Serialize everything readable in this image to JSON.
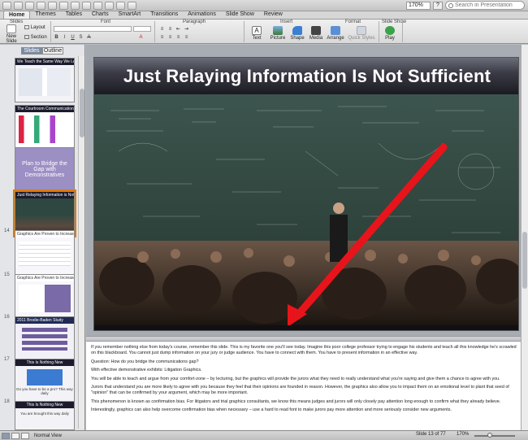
{
  "toolbar": {
    "zoom": "170%",
    "search_placeholder": "Search in Presentation"
  },
  "ribbon_tabs": [
    {
      "label": "Home",
      "active": true
    },
    {
      "label": "Themes"
    },
    {
      "label": "Tables"
    },
    {
      "label": "Charts"
    },
    {
      "label": "SmartArt"
    },
    {
      "label": "Transitions"
    },
    {
      "label": "Animations"
    },
    {
      "label": "Slide Show"
    },
    {
      "label": "Review"
    }
  ],
  "ribbon": {
    "groups": {
      "slides": "Slides",
      "font": "Font",
      "paragraph": "Paragraph",
      "insert": "Insert",
      "format": "Format",
      "slideshow": "Slide Show"
    },
    "new_slide": "New Slide",
    "layout": "Layout",
    "section": "Section",
    "insert_items": [
      "Text",
      "Picture",
      "Shape",
      "Media"
    ],
    "arrange": "Arrange",
    "quick_styles": "Quick Styles",
    "play": "Play"
  },
  "left_pane": {
    "tabs": [
      "Slides",
      "Outline"
    ],
    "slides": [
      {
        "num": "",
        "title": "We Teach the Same Way We Learn"
      },
      {
        "num": "",
        "title": "The Courtroom Communication Gap"
      },
      {
        "num": "",
        "title": "Plan to Bridge the Gap with Demonstratives"
      },
      {
        "num": "",
        "title": "Just Relaying Information is Not Sufficient"
      },
      {
        "num": "14",
        "title": "Graphics Are Proven to Increase Persuasiveness"
      },
      {
        "num": "15",
        "title": "Graphics Are Proven to Increase Persuasiveness"
      },
      {
        "num": "16",
        "title": "2011 Brodie-Baden Study"
      },
      {
        "num": "17",
        "title": "This Is Nothing New"
      },
      {
        "num": "18",
        "title": "This Is Nothing New"
      }
    ],
    "thumb_texts": {
      "s17": "Do you have to be a pro? This way daily",
      "s18": "You are brought this way daily"
    }
  },
  "slide": {
    "title": "Just Relaying Information Is Not Sufficient"
  },
  "notes": [
    "If you remember nothing else from today's course, remember this slide.  This is my favorite one you'll see today. Imagine this poor college professor trying to engage his students and teach all this knowledge he's scrawled on this blackboard.  You cannot just dump information on your jury or judge audience.  You have to connect with them.  You have to present information in an effective way.",
    "Question: How do you bridge the communications gap?",
    "With effective demonstrative exhibits: Litigation Graphics.",
    "You will be able to teach and argue from your comfort-zone – by lecturing, but the graphics will provide the jurors what they need to really understand what you're saying and give them a chance to agree with you.",
    "Jurors that understand you are more likely to agree with you because they feel that their opinions are founded in reason.  However, the graphics also allow you to impact them on an emotional level to plant that seed of \"opinion\" that can be confirmed by your argument, which may be more important.",
    "This phenomenon is known as confirmation bias.  For litigators and trial graphics consultants, we know this means judges and jurors will only closely pay attention long enough to confirm what they already believe.",
    "Interestingly, graphics can also help overcome confirmation bias when necessary – use a hard to read font to make jurors pay more attention and more seriously consider new arguments."
  ],
  "status": {
    "view": "Normal View",
    "slide_of": "Slide 13 of 77",
    "zoom": "170%"
  },
  "colors": {
    "arrow": "#e8141b",
    "selection": "#e07b00",
    "chalkboard": "#2f4741"
  }
}
